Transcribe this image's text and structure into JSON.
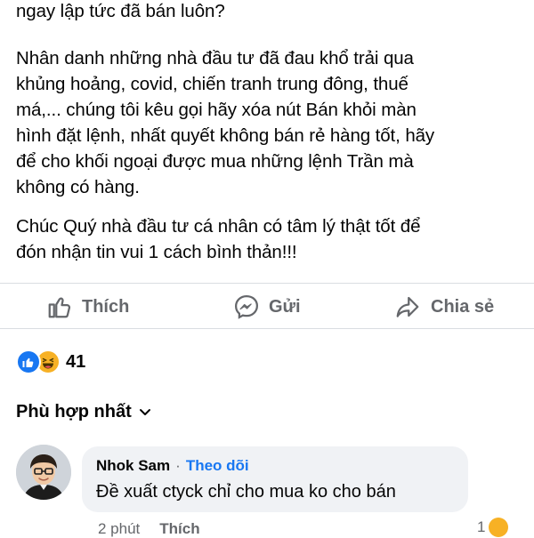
{
  "post": {
    "line0": "ngay lập tức đã bán luôn?",
    "para2": [
      "Nhân danh những nhà đầu tư đã đau khổ trải qua",
      "khủng hoảng, covid, chiến tranh trung đông, thuế",
      "má,... chúng tôi kêu gọi hãy xóa nút Bán khỏi màn",
      "hình đặt lệnh, nhất quyết không bán rẻ hàng tốt, hãy",
      "để cho khối ngoại được mua những lệnh Trần mà",
      "không có hàng."
    ],
    "para3": [
      "Chúc Quý nhà đầu tư cá nhân có tâm lý thật tốt để",
      "đón nhận tin vui 1 cách bình thản!!!"
    ]
  },
  "actions": {
    "like": {
      "label": "Thích",
      "icon": "thumbs-up-icon"
    },
    "comment": {
      "label": "Gửi",
      "icon": "messenger-icon"
    },
    "share": {
      "label": "Chia sẻ",
      "icon": "share-arrow-icon"
    }
  },
  "reactions": {
    "count": "41",
    "types": [
      "like",
      "haha"
    ],
    "colors": {
      "like": "#1877f2",
      "haha": "#f7b125"
    }
  },
  "comments": {
    "sort_label": "Phù hợp nhất",
    "items": [
      {
        "author": "Nhok Sam",
        "separator": "·",
        "follow_label": "Theo dõi",
        "text": "Đề xuất ctyck chỉ cho mua ko cho bán",
        "time": "2 phút",
        "like_label": "Thích",
        "reaction_count": "1"
      }
    ]
  },
  "colors": {
    "accent": "#1877f2",
    "muted": "#65676b",
    "bubble": "#f0f2f5"
  }
}
